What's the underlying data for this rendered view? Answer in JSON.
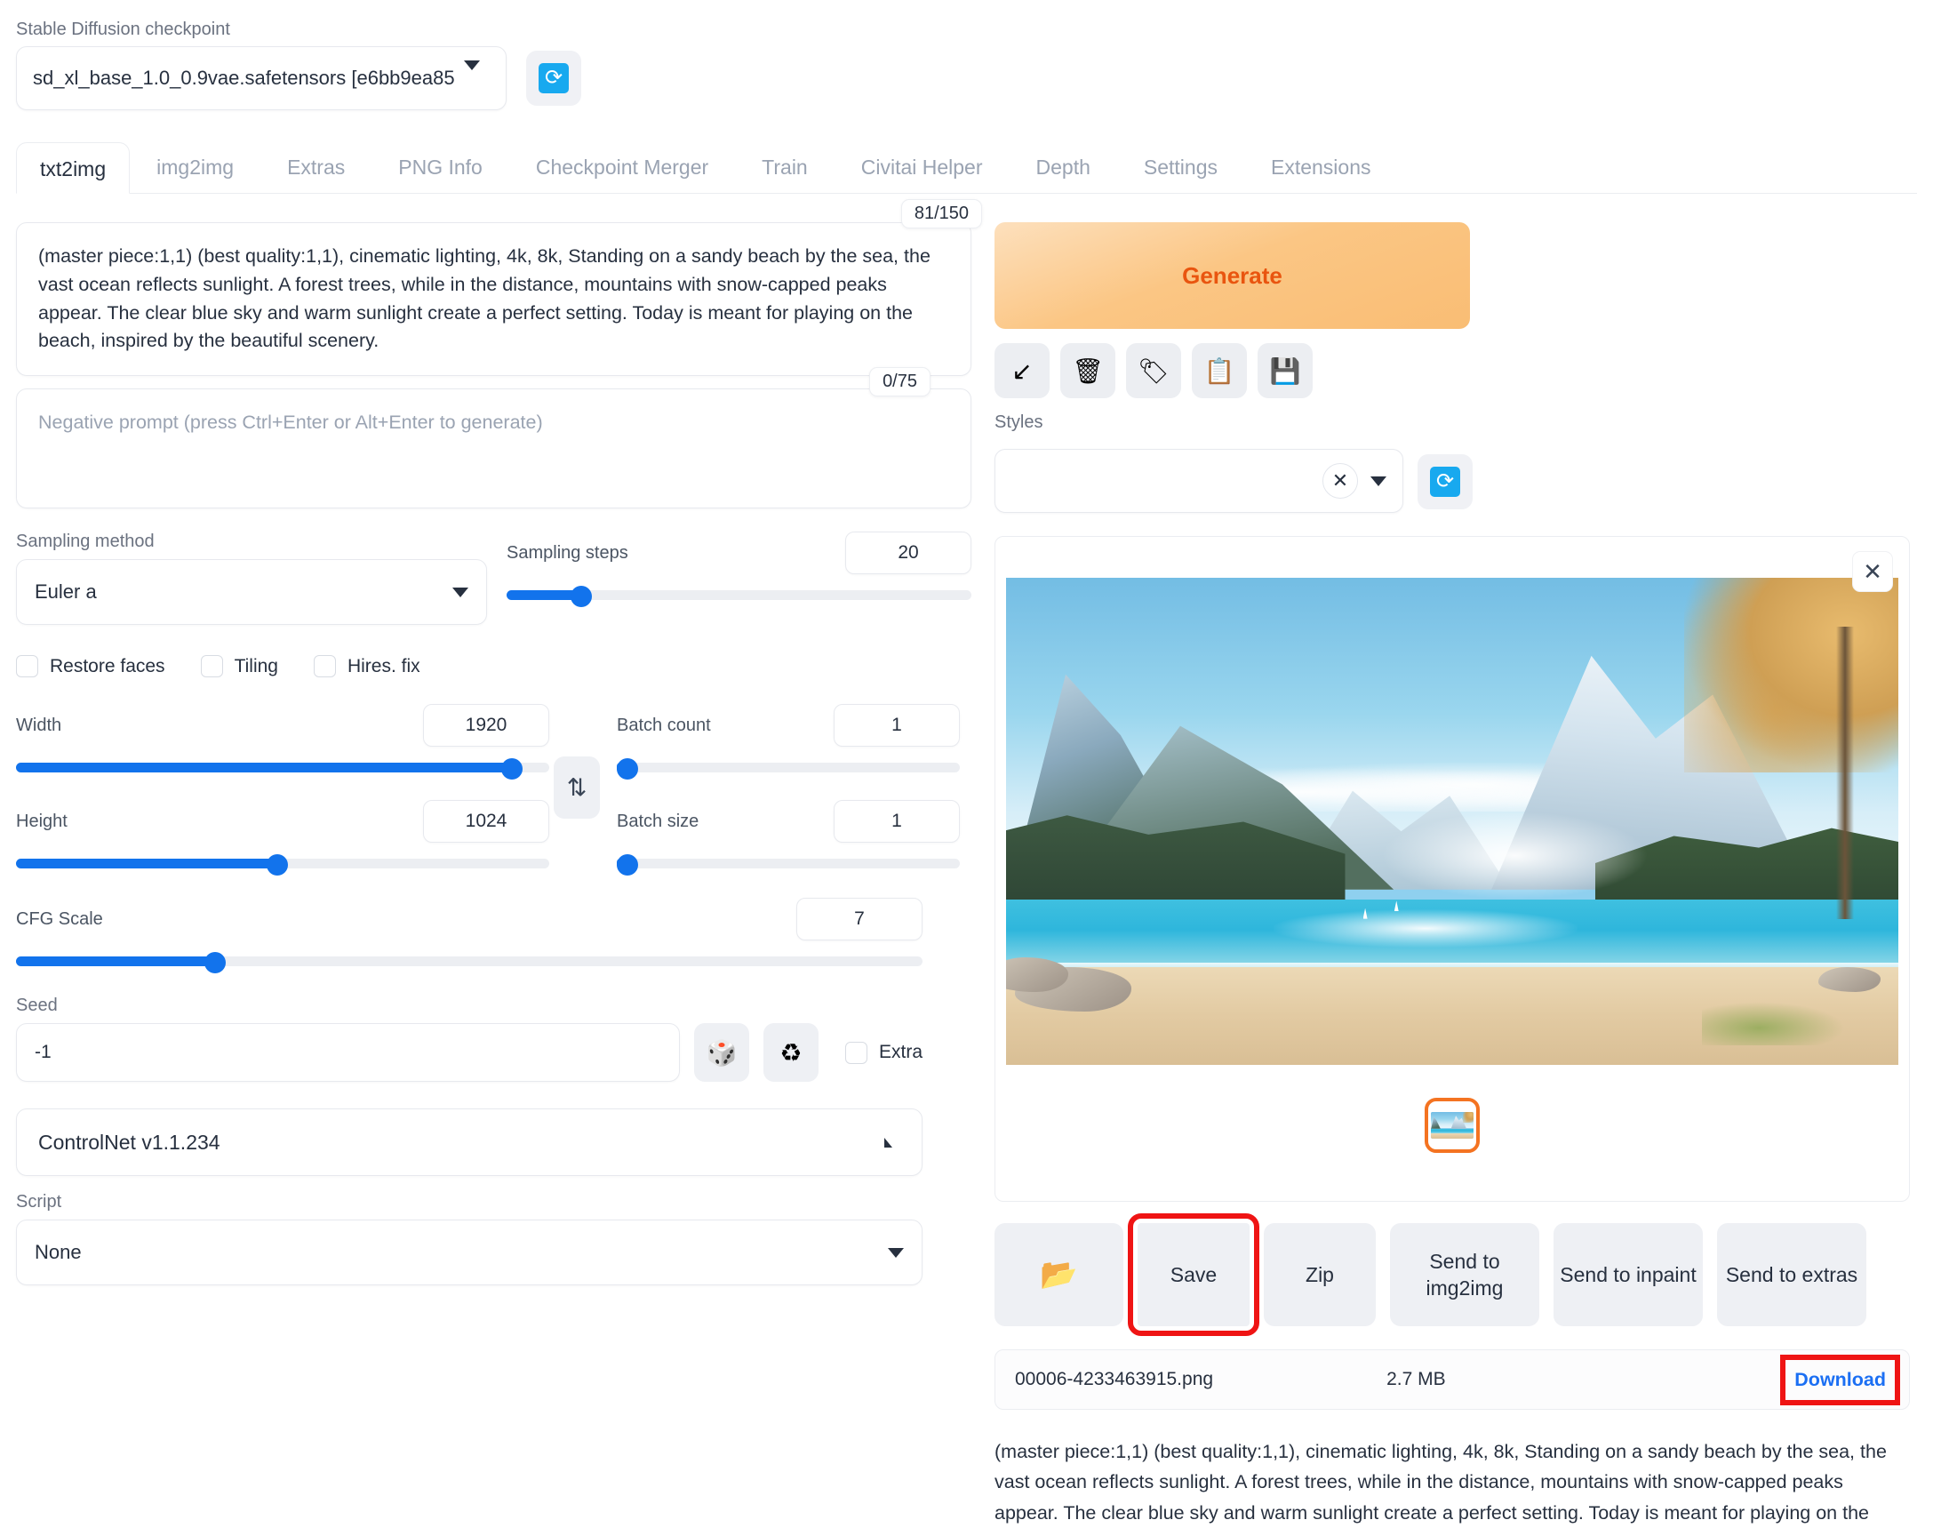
{
  "checkpoint": {
    "label": "Stable Diffusion checkpoint",
    "value": "sd_xl_base_1.0_0.9vae.safetensors [e6bb9ea85",
    "refresh_icon": "refresh-icon"
  },
  "tabs": [
    {
      "label": "txt2img",
      "active": true
    },
    {
      "label": "img2img",
      "active": false
    },
    {
      "label": "Extras",
      "active": false
    },
    {
      "label": "PNG Info",
      "active": false
    },
    {
      "label": "Checkpoint Merger",
      "active": false
    },
    {
      "label": "Train",
      "active": false
    },
    {
      "label": "Civitai Helper",
      "active": false
    },
    {
      "label": "Depth",
      "active": false
    },
    {
      "label": "Settings",
      "active": false
    },
    {
      "label": "Extensions",
      "active": false
    }
  ],
  "prompt": {
    "value": "(master piece:1,1) (best quality:1,1), cinematic lighting, 4k, 8k, Standing on a sandy beach by the sea, the vast ocean reflects sunlight. A forest trees, while in the distance, mountains with snow-capped peaks appear. The clear blue sky and warm sunlight create a perfect setting.  Today is meant for playing on the beach, inspired by the beautiful scenery.",
    "counter": "81/150"
  },
  "negative_prompt": {
    "placeholder": "Negative prompt (press Ctrl+Enter or Alt+Enter to generate)",
    "value": "",
    "counter": "0/75"
  },
  "generate": {
    "label": "Generate",
    "accent_color": "#e9550f",
    "icons": [
      {
        "name": "arrow-southwest-icon",
        "glyph": "↙"
      },
      {
        "name": "trash-icon",
        "glyph": "🗑"
      },
      {
        "name": "paint-palette-icon",
        "glyph": "🏷"
      },
      {
        "name": "clipboard-icon",
        "glyph": "📋"
      },
      {
        "name": "floppy-disk-icon",
        "glyph": "💾"
      }
    ]
  },
  "styles": {
    "label": "Styles",
    "value": "",
    "clear_icon": "close-icon",
    "refresh_icon": "refresh-icon"
  },
  "settings": {
    "sampling_method": {
      "label": "Sampling method",
      "value": "Euler a"
    },
    "sampling_steps": {
      "label": "Sampling steps",
      "value": "20",
      "fill_percent": 16
    },
    "checkboxes": [
      {
        "label": "Restore faces",
        "checked": false
      },
      {
        "label": "Tiling",
        "checked": false
      },
      {
        "label": "Hires. fix",
        "checked": false
      }
    ],
    "width": {
      "label": "Width",
      "value": "1920",
      "fill_percent": 93
    },
    "height": {
      "label": "Height",
      "value": "1024",
      "fill_percent": 49
    },
    "batch_count": {
      "label": "Batch count",
      "value": "1",
      "fill_percent": 2
    },
    "batch_size": {
      "label": "Batch size",
      "value": "1",
      "fill_percent": 2
    },
    "cfg_scale": {
      "label": "CFG Scale",
      "value": "7",
      "fill_percent": 22
    },
    "seed": {
      "label": "Seed",
      "value": "-1"
    },
    "seed_buttons": [
      {
        "name": "dice-icon",
        "glyph": "🎲"
      },
      {
        "name": "recycle-icon",
        "glyph": "♻"
      }
    ],
    "extra_checkbox": {
      "label": "Extra",
      "checked": false
    },
    "swap_button": {
      "name": "swap-dimensions-icon",
      "glyph": "⇅"
    },
    "controlnet": {
      "label": "ControlNet v1.1.234",
      "collapsed": true
    },
    "script": {
      "label": "Script",
      "value": "None"
    }
  },
  "result": {
    "close_icon": "close-icon",
    "thumbnail_selected": true,
    "thumbnail_border_color": "#f47321",
    "actions": [
      {
        "label": "",
        "name": "open-folder-button",
        "icon": "folder-icon",
        "glyph": "📂",
        "highlighted": false
      },
      {
        "label": "Save",
        "name": "save-button",
        "highlighted": true
      },
      {
        "label": "Zip",
        "name": "zip-button",
        "highlighted": false
      },
      {
        "label": "Send to img2img",
        "name": "send-to-img2img-button",
        "highlighted": false
      },
      {
        "label": "Send to inpaint",
        "name": "send-to-inpaint-button",
        "highlighted": false
      },
      {
        "label": "Send to extras",
        "name": "send-to-extras-button",
        "highlighted": false
      }
    ],
    "file": {
      "name": "00006-4233463915.png",
      "size": "2.7 MB",
      "download_label": "Download",
      "download_highlighted": true,
      "download_color": "#1b6ff3"
    },
    "prompt_text": "(master piece:1,1) (best quality:1,1), cinematic lighting, 4k, 8k, Standing on a sandy beach by the sea, the vast ocean reflects sunlight. A forest trees, while in the distance, mountains with snow-capped peaks appear. The clear blue sky and warm sunlight create a perfect setting. Today is meant for playing on the"
  },
  "highlight_color": "#ef1414"
}
